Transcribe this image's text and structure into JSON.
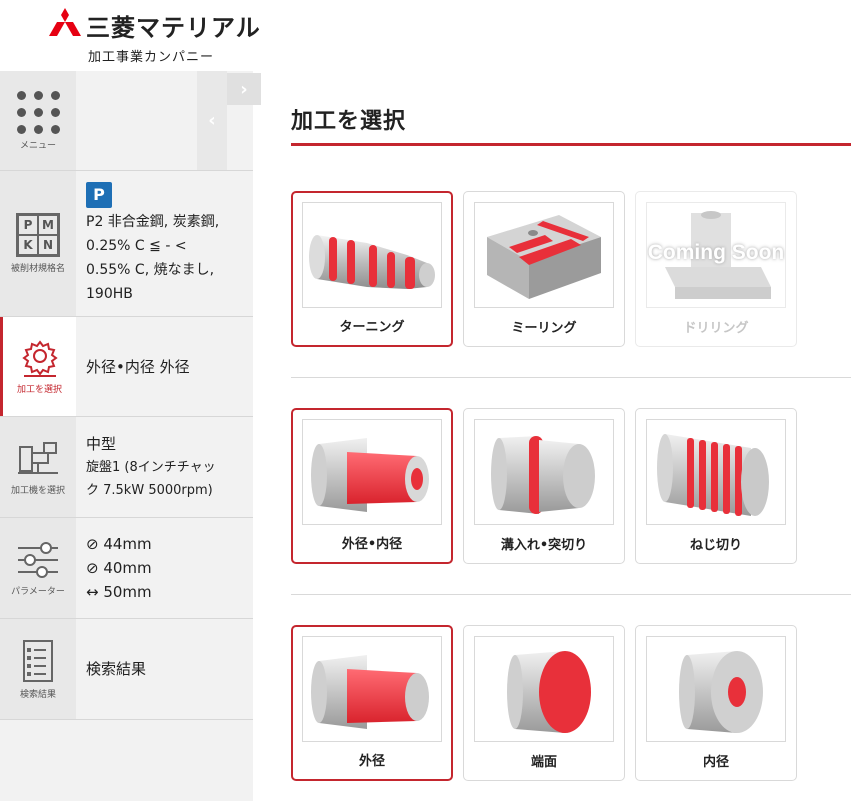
{
  "brand": {
    "name": "三菱マテリアル",
    "sub": "加工事業カンパニー",
    "accent": "#c4262e"
  },
  "sidebar": {
    "menu": {
      "label": "メニュー"
    },
    "material": {
      "label": "被削材規格名",
      "badge": "P",
      "line1": "P2 非合金鋼, 炭素鋼,",
      "line2": "0.25% C ≦ - <",
      "line3": "0.55% C, 焼なまし,",
      "line4": "190HB"
    },
    "process": {
      "label": "加工を選択",
      "text": "外径•内径 外径"
    },
    "machine": {
      "label": "加工機を選択",
      "title": "中型",
      "line1": "旋盤1 (8インチチャッ",
      "line2": "ク 7.5kW 5000rpm)"
    },
    "params": {
      "label": "パラメーター",
      "p1": "⊘ 44mm",
      "p2": "⊘ 40mm",
      "p3": "↔ 50mm"
    },
    "results": {
      "label": "検索結果",
      "text": "検索結果"
    }
  },
  "main": {
    "title": "加工を選択",
    "row1": [
      {
        "label": "ターニング",
        "selected": true
      },
      {
        "label": "ミーリング",
        "selected": false
      },
      {
        "label": "ドリリング",
        "disabled": true,
        "overlay": "Coming Soon"
      }
    ],
    "row2": [
      {
        "label": "外径•内径",
        "selected": true
      },
      {
        "label": "溝入れ•突切り",
        "selected": false
      },
      {
        "label": "ねじ切り",
        "selected": false
      }
    ],
    "row3": [
      {
        "label": "外径",
        "selected": true
      },
      {
        "label": "端面",
        "selected": false
      },
      {
        "label": "内径",
        "selected": false
      }
    ]
  }
}
